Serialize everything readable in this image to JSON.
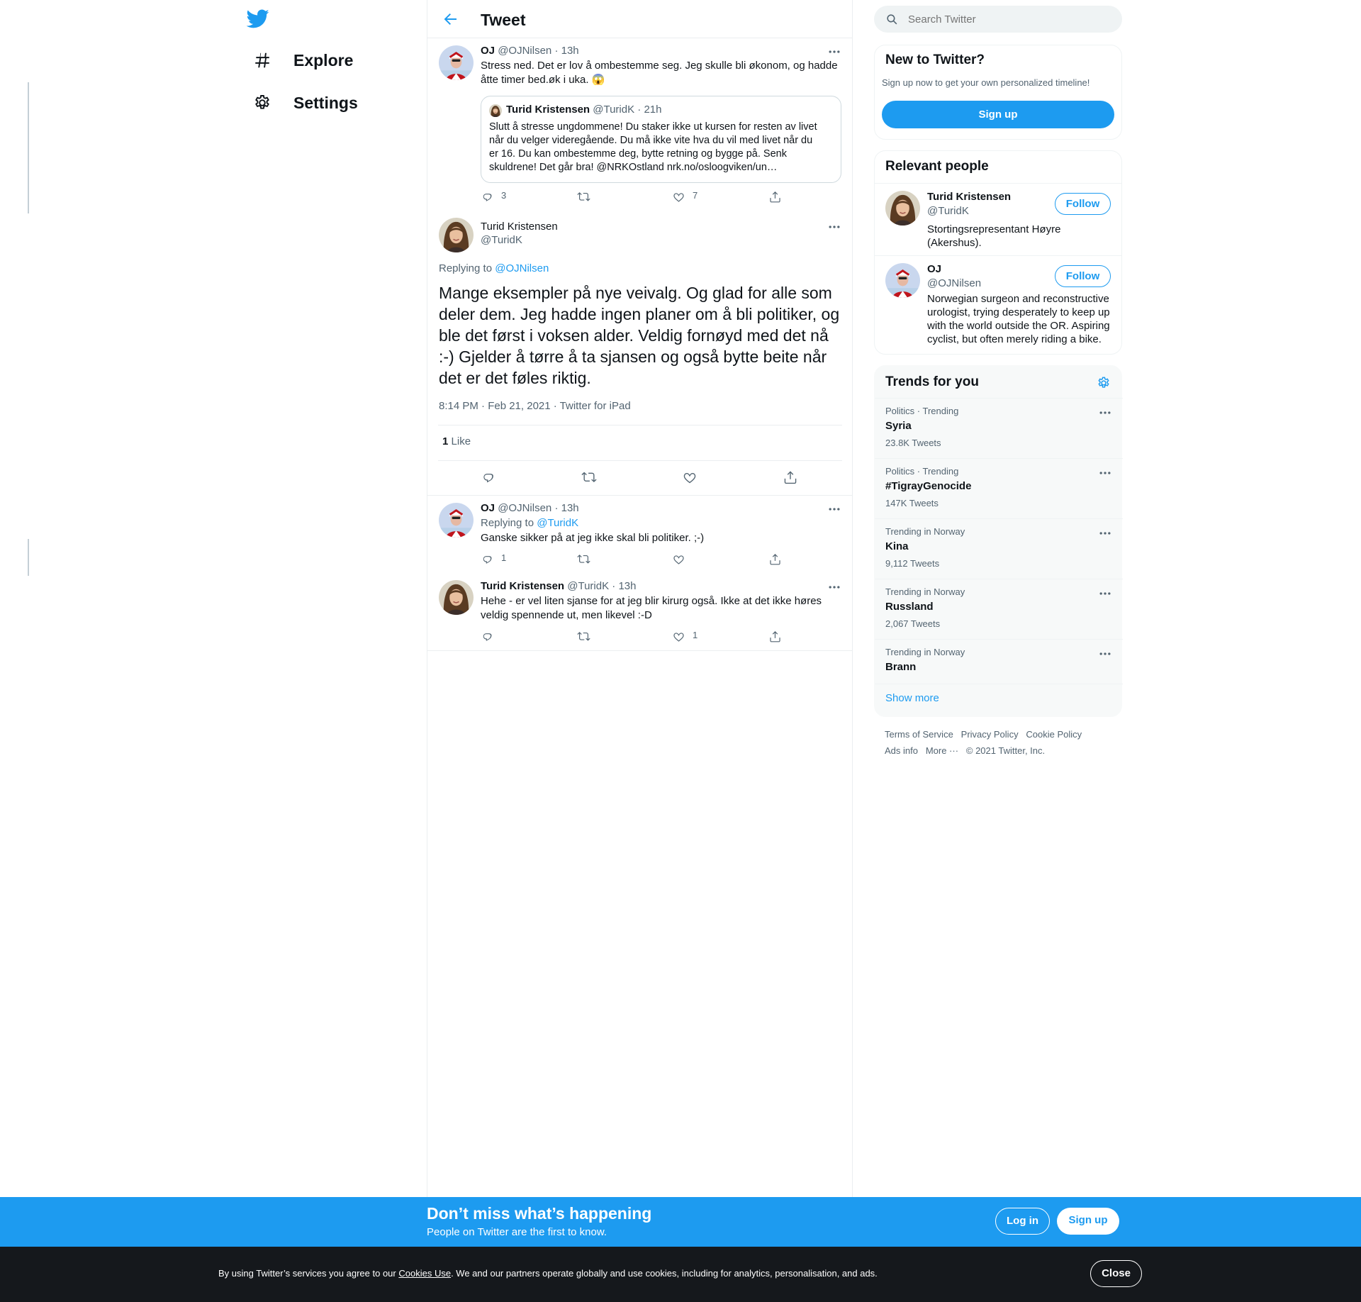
{
  "nav": {
    "explore": "Explore",
    "settings": "Settings"
  },
  "header": {
    "title": "Tweet"
  },
  "tweet1": {
    "name": "OJ",
    "handle": "@OJNilsen",
    "time": "· 13h",
    "text1": "Stress ned. Det er lov å ombestemme seg. Jeg skulle bli økonom, og hadde",
    "text2": "åtte timer bed.øk i uka. 😱",
    "reply_count": "3",
    "like_count": "7",
    "quote": {
      "name": "Turid Kristensen",
      "handle": "@TuridK",
      "time": "· 21h",
      "lines": [
        "Slutt å stresse ungdommene! Du staker ikke ut kursen for resten av livet",
        "når du velger videregående. Du må ikke vite hva du vil med livet når du",
        "er 16. Du kan ombestemme deg, bytte retning og bygge på. Senk",
        "skuldrene! Det går bra! @NRKOstland nrk.no/osloogviken/un…"
      ]
    }
  },
  "main_tweet": {
    "name": "Turid Kristensen",
    "handle": "@TuridK",
    "replying_prefix": "Replying to ",
    "replying_to": "@OJNilsen",
    "lines": [
      "Mange eksempler på nye veivalg. Og glad for alle som",
      "deler dem. Jeg hadde ingen planer om å bli politiker, og",
      "ble det først i voksen alder. Veldig fornøyd med det nå",
      ":-) Gjelder å tørre å ta sjansen og også bytte beite når",
      "det er det føles riktig."
    ],
    "timestamp": "8:14 PM · Feb 21, 2021 · Twitter for iPad",
    "likes_num": "1",
    "likes_label": "Like"
  },
  "reply1": {
    "name": "OJ",
    "handle": "@OJNilsen",
    "time": "· 13h",
    "replying_prefix": "Replying to ",
    "replying_to": "@TuridK",
    "text": "Ganske sikker på at jeg ikke skal bli politiker. ;-)",
    "reply_count": "1"
  },
  "reply2": {
    "name": "Turid Kristensen",
    "handle": "@TuridK",
    "time": "· 13h",
    "text1": "Hehe - er vel liten sjanse for at jeg blir kirurg også. Ikke at det ikke høres",
    "text2": "veldig spennende ut, men likevel :-D",
    "like_count": "1"
  },
  "search": {
    "placeholder": "Search Twitter"
  },
  "new_to_twitter": {
    "title": "New to Twitter?",
    "subtitle": "Sign up now to get your own personalized timeline!",
    "button": "Sign up"
  },
  "relevant": {
    "title": "Relevant people",
    "follow_label": "Follow",
    "people": [
      {
        "name": "Turid Kristensen",
        "handle": "@TuridK",
        "bio": [
          "Stortingsrepresentant Høyre",
          "(Akershus)."
        ]
      },
      {
        "name": "OJ",
        "handle": "@OJNilsen",
        "bio": [
          "Norwegian surgeon and reconstructive",
          "urologist, trying desperately to keep up",
          "with the world outside the OR. Aspiring",
          "cyclist, but often merely riding a bike."
        ]
      }
    ]
  },
  "trends": {
    "title": "Trends for you",
    "items": [
      {
        "context": "Politics · Trending",
        "name": "Syria",
        "count": "23.8K Tweets"
      },
      {
        "context": "Politics · Trending",
        "name": "#TigrayGenocide",
        "count": "147K Tweets"
      },
      {
        "context": "Trending in Norway",
        "name": "Kina",
        "count": "9,112 Tweets"
      },
      {
        "context": "Trending in Norway",
        "name": "Russland",
        "count": "2,067 Tweets"
      },
      {
        "context": "Trending in Norway",
        "name": "Brann",
        "count": ""
      }
    ],
    "show_more": "Show more"
  },
  "footer": {
    "terms": "Terms of Service",
    "privacy": "Privacy Policy",
    "cookie": "Cookie Policy",
    "ads": "Ads info",
    "more": "More ···",
    "copyright": "© 2021 Twitter, Inc."
  },
  "banner": {
    "headline": "Don’t miss what’s happening",
    "sub": "People on Twitter are the first to know.",
    "login": "Log in",
    "signup": "Sign up"
  },
  "cookie_bar": {
    "prefix": "By using Twitter’s services you agree to our ",
    "link": "Cookies Use",
    "suffix": ". We and our partners operate globally and use cookies, including for analytics, personalisation, and ads.",
    "close": "Close"
  },
  "colors": {
    "accent": "#1d9bf0",
    "text": "#0f1419",
    "muted": "#536471",
    "dark_bar": "#15181c"
  }
}
